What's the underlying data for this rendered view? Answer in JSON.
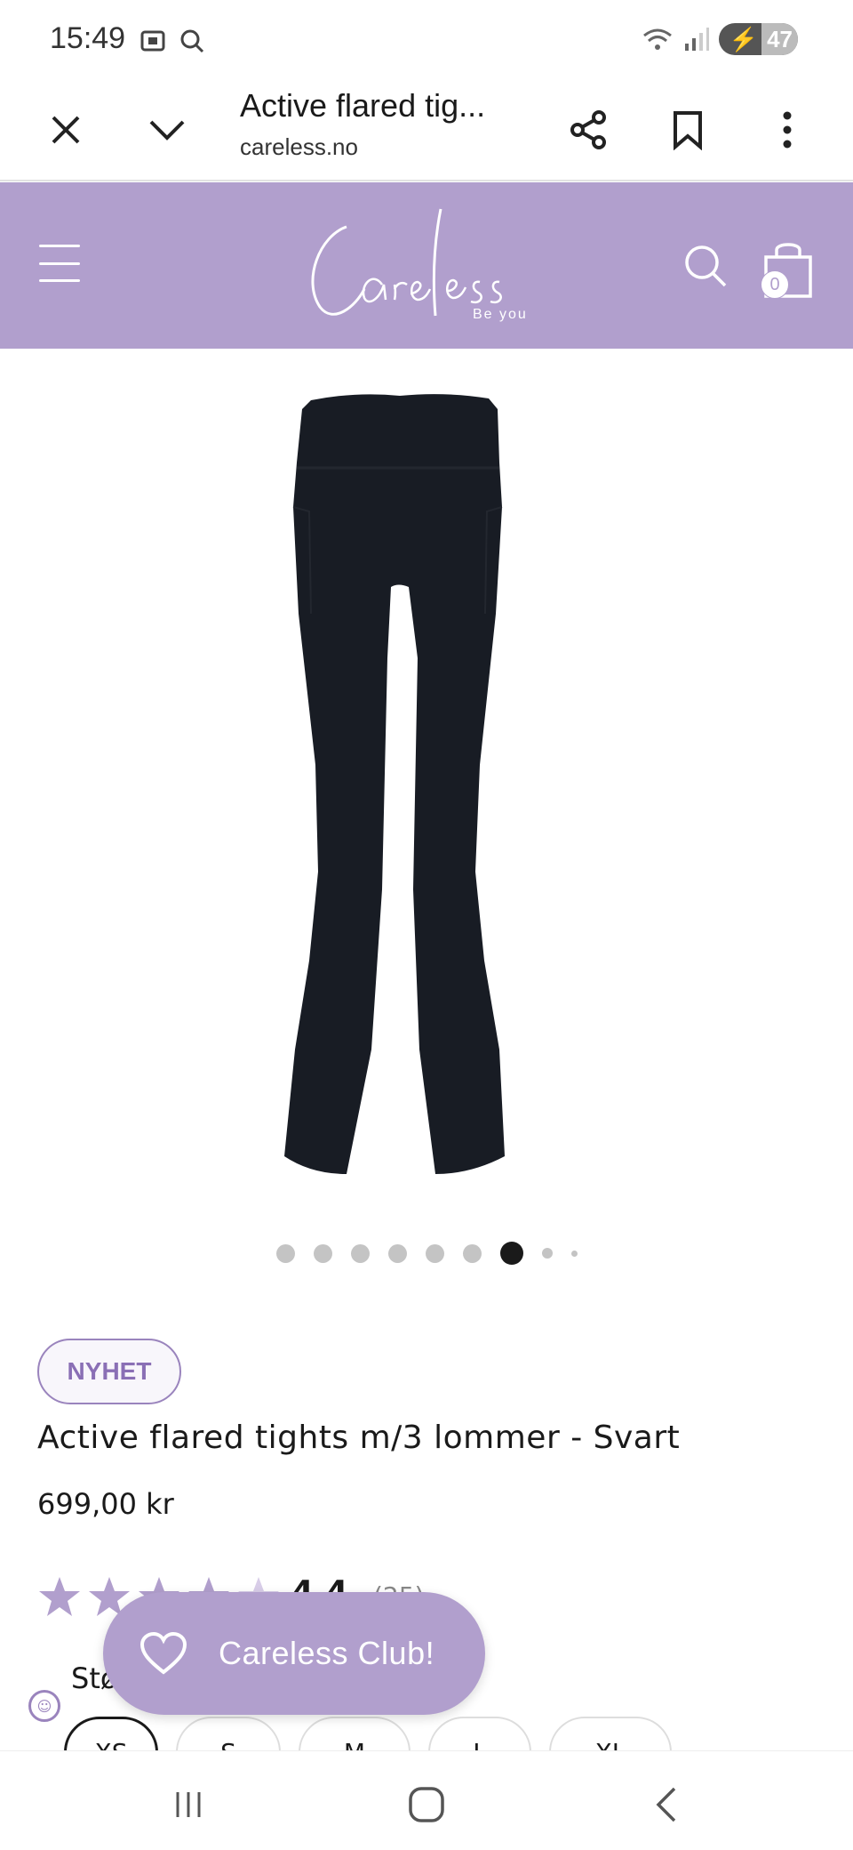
{
  "status_bar": {
    "time": "15:49",
    "battery": "47"
  },
  "browser": {
    "page_title": "Active flared tig...",
    "domain": "careless.no",
    "icons": [
      "close-icon",
      "chevron-down-icon",
      "share-icon",
      "bookmark-icon",
      "more-vert-icon"
    ]
  },
  "site_header": {
    "background_color": "#b19fcd",
    "logo_text": "Careless",
    "logo_tagline": "Be you",
    "cart_count": "0"
  },
  "carousel": {
    "total_slides": 9,
    "active_index": 6
  },
  "product": {
    "badge": "NYHET",
    "title": "Active flared tights m/3 lommer - Svart",
    "price": "699,00 kr",
    "rating_value": "4.4",
    "rating_count": "(25)",
    "size_label": "Størrelse",
    "sizes": [
      "XS",
      "S",
      "M",
      "L",
      "XL"
    ],
    "selected_size": "XS"
  },
  "club_button": {
    "label": "Careless Club!"
  }
}
